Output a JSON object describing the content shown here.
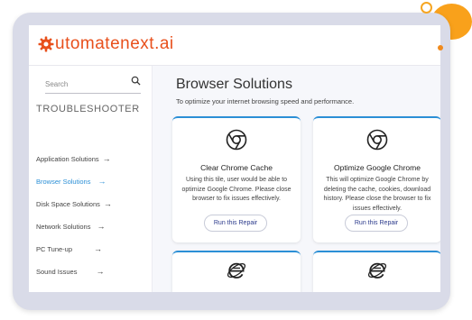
{
  "brand": {
    "logo_part1": "utomate",
    "logo_part2": "next",
    "logo_part3": ".ai"
  },
  "sidebar": {
    "search_placeholder": "Search",
    "heading": "TROUBLESHOOTER",
    "items": [
      {
        "label": "Application Solutions",
        "active": false
      },
      {
        "label": "Browser Solutions",
        "active": true
      },
      {
        "label": "Disk Space Solutions",
        "active": false
      },
      {
        "label": "Network Solutions",
        "active": false
      },
      {
        "label": "PC Tune-up",
        "active": false
      },
      {
        "label": "Sound Issues",
        "active": false
      }
    ],
    "arrow_glyph": "→"
  },
  "main": {
    "title": "Browser Solutions",
    "subtitle": "To optimize your internet browsing speed and performance.",
    "cards": [
      {
        "icon": "chrome-icon",
        "title": "Clear Chrome Cache",
        "description": "Using this tile, user would be able to optimize Google Chrome. Please close browser to fix issues effectively.",
        "button": "Run this Repair"
      },
      {
        "icon": "chrome-icon",
        "title": "Optimize Google Chrome",
        "description": "This will optimize Google Chrome by deleting the cache, cookies, download history. Please close the browser to fix issues effectively.",
        "button": "Run this Repair"
      },
      {
        "icon": "internet-explorer-icon",
        "title": "",
        "description": "",
        "button": ""
      },
      {
        "icon": "internet-explorer-icon",
        "title": "",
        "description": "",
        "button": ""
      }
    ]
  },
  "colors": {
    "accent": "#2b8fd6",
    "brand_orange": "#e8501c",
    "decor_orange": "#f9a11b",
    "frame": "#d9dbe8"
  }
}
